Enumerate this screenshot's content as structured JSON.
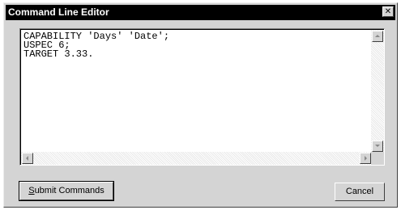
{
  "window": {
    "title": "Command Line Editor",
    "close_glyph": "✕"
  },
  "editor": {
    "text": "CAPABILITY 'Days' 'Date';\nUSPEC 6;\nTARGET 3.33."
  },
  "buttons": {
    "submit_mnemonic": "S",
    "submit_rest": "ubmit Commands",
    "cancel_label": "Cancel"
  }
}
